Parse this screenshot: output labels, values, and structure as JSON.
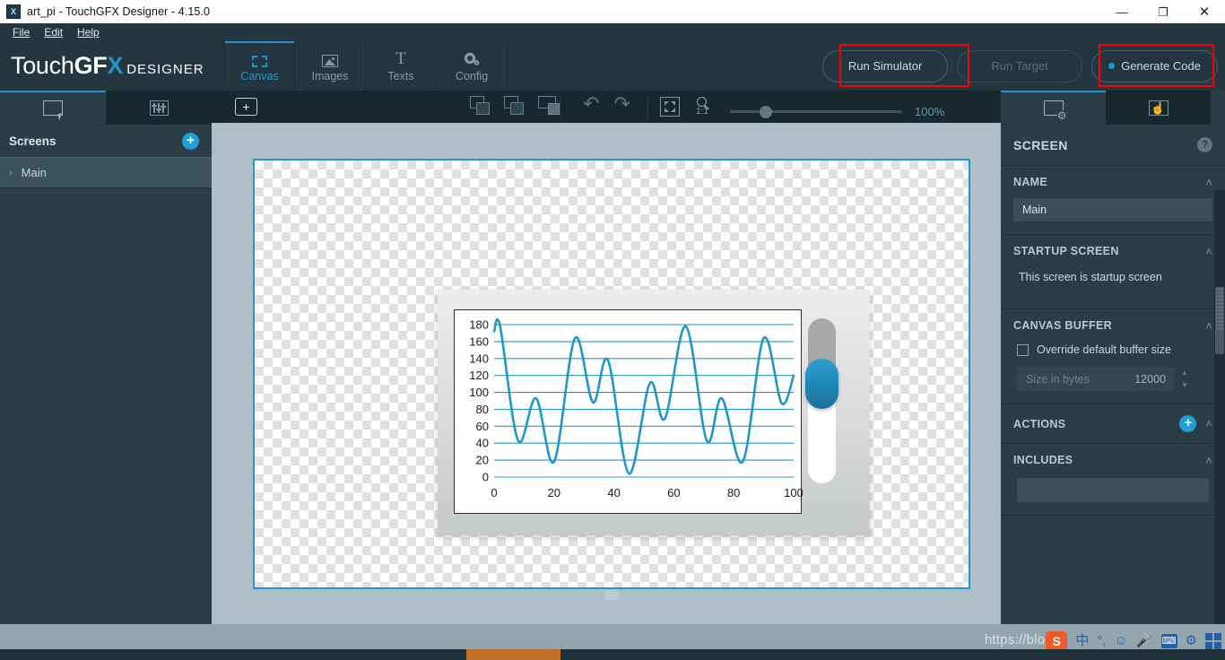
{
  "window": {
    "title": "art_pi - TouchGFX Designer - 4.15.0",
    "app_icon": "app-icon",
    "minimize": "—",
    "restore": "❐",
    "close": "✕"
  },
  "menu": {
    "items": [
      {
        "label": "File",
        "accel": "F"
      },
      {
        "label": "Edit",
        "accel": "E"
      },
      {
        "label": "Help",
        "accel": "H"
      }
    ]
  },
  "brand": {
    "part1": "Touch",
    "part2": "GF",
    "part3": "X",
    "suffix": "DESIGNER"
  },
  "tabs": [
    {
      "label": "Canvas",
      "icon": "dashed-rectangle-icon",
      "active": true
    },
    {
      "label": "Images",
      "icon": "image-icon",
      "active": false
    },
    {
      "label": "Texts",
      "icon": "text-t-icon",
      "active": false
    },
    {
      "label": "Config",
      "icon": "gear-icon",
      "active": false
    }
  ],
  "actions": {
    "run_simulator": "Run Simulator",
    "run_target": "Run Target",
    "generate_code": "Generate Code",
    "highlight_color": "#fe0000",
    "accent_color": "#2196c9"
  },
  "toolbar": {
    "add_label": "+",
    "bring_front": "bring-to-front",
    "send_back": "send-to-back",
    "group": "group-selection",
    "undo": "↶",
    "redo": "↷",
    "fit_to_screen": "fit-to-screen",
    "zoom_one_to_one": "1:1",
    "zoom_value": "100%",
    "zoom_slider_position": 21
  },
  "left_panel": {
    "tabs": [
      {
        "icon": "screen-select-icon",
        "active": true
      },
      {
        "icon": "mixer-icon",
        "active": false
      }
    ],
    "header": "Screens",
    "add_button": "+",
    "items": [
      {
        "label": "Main",
        "chevron": "›"
      }
    ]
  },
  "right_panel": {
    "tabs": [
      {
        "icon": "screen-properties-icon",
        "active": true
      },
      {
        "icon": "interactions-hand-icon",
        "active": false
      }
    ],
    "title": "SCREEN",
    "help": "?",
    "sections": [
      {
        "title": "NAME",
        "collapse": "˄"
      },
      {
        "title": "STARTUP SCREEN",
        "collapse": "˄"
      },
      {
        "title": "CANVAS BUFFER",
        "collapse": "˄"
      },
      {
        "title": "ACTIONS",
        "collapse": "˄"
      },
      {
        "title": "INCLUDES",
        "collapse": "˄"
      }
    ],
    "name_value": "Main",
    "startup_text": "This screen is startup screen",
    "override_label": "Override default buffer size",
    "size_placeholder": "Size in bytes",
    "size_value": "12000",
    "actions_add": "+",
    "includes_value": ""
  },
  "canvas": {
    "selection_color": "#2196c9",
    "background": "#aebfc7"
  },
  "chart_data": {
    "type": "line",
    "title": "",
    "xlabel": "",
    "ylabel": "",
    "xlim": [
      0,
      100
    ],
    "ylim": [
      0,
      180
    ],
    "xticks": [
      0,
      20,
      40,
      60,
      80,
      100
    ],
    "yticks": [
      0,
      20,
      40,
      60,
      80,
      100,
      120,
      140,
      160,
      180
    ],
    "grid": "horizontal",
    "line_color": "#2196c9",
    "legend": "none",
    "x": [
      0,
      2,
      8,
      14,
      20,
      27,
      33,
      38,
      45,
      52,
      57,
      64,
      71,
      76,
      83,
      90,
      96,
      100
    ],
    "values": [
      172,
      178,
      43,
      93,
      18,
      164,
      88,
      138,
      4,
      111,
      69,
      178,
      43,
      93,
      18,
      164,
      87,
      120
    ]
  },
  "device_widget": {
    "slider": {
      "name": "vertical-slider",
      "orientation": "vertical",
      "knob_color": "#1e86b5",
      "filled_color": "#a8a8a8",
      "track_color": "#ffffff",
      "position_percent": 35
    }
  },
  "bottom": {
    "watermark": "https://blo",
    "ime": {
      "sogou": "S",
      "lang": "中",
      "punct": "°,",
      "emoji": "☺",
      "mic": "⬤",
      "keyboard": "⌨",
      "toolbox": "⚙",
      "apps": "▦"
    }
  }
}
